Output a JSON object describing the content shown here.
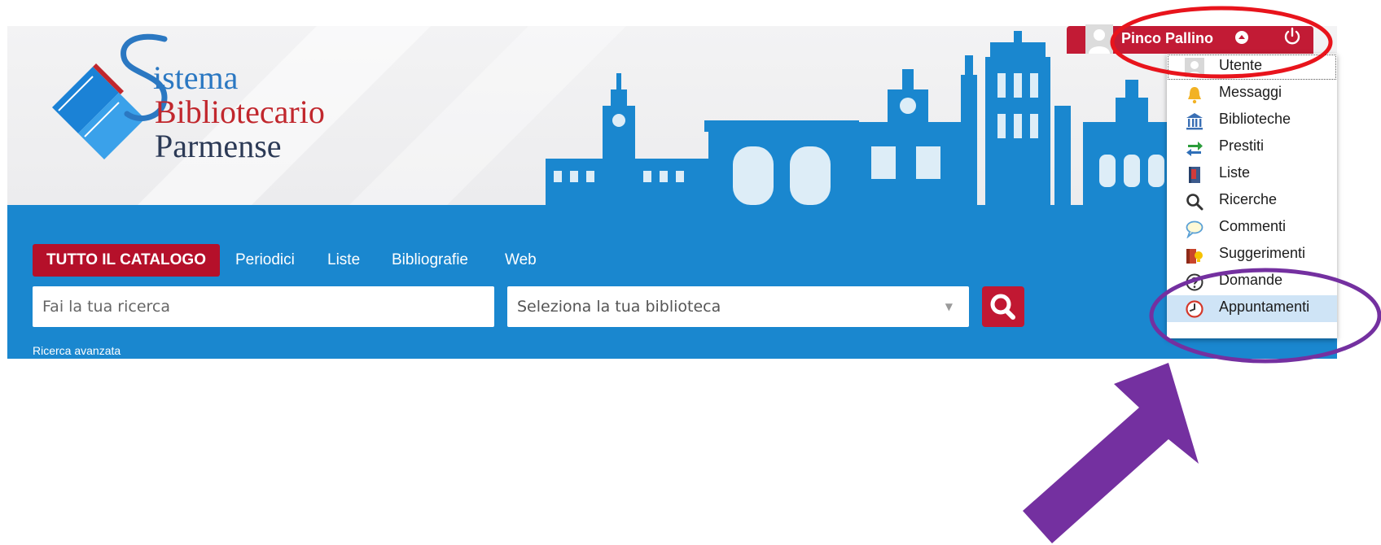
{
  "header": {
    "logo": {
      "line1": "istema",
      "line2": "Bibliotecario",
      "line3": "Parmense",
      "initial": "S"
    }
  },
  "nav": {
    "tabs": [
      {
        "label": "TUTTO IL CATALOGO",
        "active": true
      },
      {
        "label": "Periodici"
      },
      {
        "label": "Liste"
      },
      {
        "label": "Bibliografie"
      },
      {
        "label": "Web"
      }
    ]
  },
  "search": {
    "input_placeholder": "Fai la tua ricerca",
    "library_placeholder": "Seleziona la tua biblioteca",
    "advanced_link": "Ricerca avanzata"
  },
  "user": {
    "name": "Pinco Pallino",
    "menu": [
      {
        "label": "Utente",
        "icon": "user-icon"
      },
      {
        "label": "Messaggi",
        "icon": "bell-icon"
      },
      {
        "label": "Biblioteche",
        "icon": "library-icon"
      },
      {
        "label": "Prestiti",
        "icon": "exchange-arrows-icon"
      },
      {
        "label": "Liste",
        "icon": "book-list-icon"
      },
      {
        "label": "Ricerche",
        "icon": "search-icon"
      },
      {
        "label": "Commenti",
        "icon": "speech-bubble-icon"
      },
      {
        "label": "Suggerimenti",
        "icon": "suggestion-icon"
      },
      {
        "label": "Domande",
        "icon": "question-icon"
      },
      {
        "label": "Appuntamenti",
        "icon": "clock-icon"
      }
    ]
  },
  "colors": {
    "brand_blue": "#1a87cf",
    "brand_red": "#c11832",
    "highlight": "#cfe4f6",
    "annotation_red": "#e8141c",
    "annotation_purple": "#7430a0"
  }
}
